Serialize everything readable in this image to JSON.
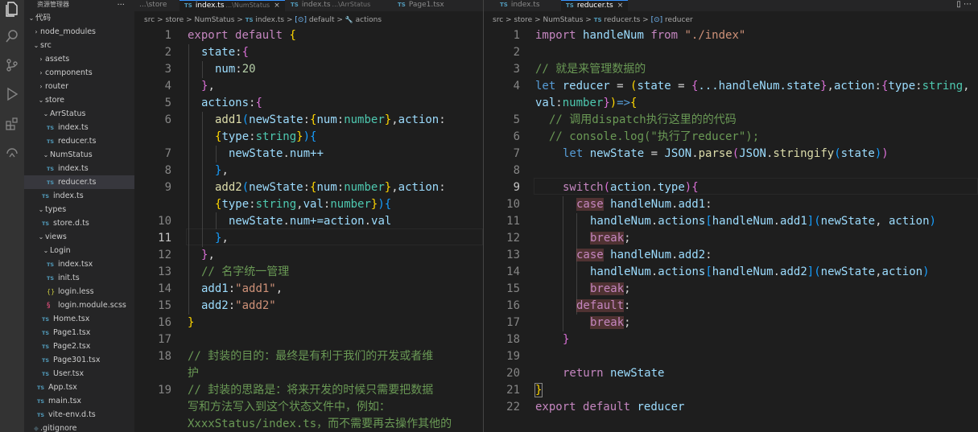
{
  "sidebar": {
    "title": "资源管理器",
    "more": "...",
    "tree": [
      {
        "label": "代码",
        "depth": 0,
        "chev": "⌄",
        "icon": "folder-open"
      },
      {
        "label": "node_modules",
        "depth": 1,
        "chev": "›",
        "icon": "folder"
      },
      {
        "label": "src",
        "depth": 1,
        "chev": "⌄",
        "icon": "folder-open"
      },
      {
        "label": "assets",
        "depth": 2,
        "chev": "›",
        "icon": "folder"
      },
      {
        "label": "components",
        "depth": 2,
        "chev": "›",
        "icon": "folder"
      },
      {
        "label": "router",
        "depth": 2,
        "chev": "›",
        "icon": "folder"
      },
      {
        "label": "store",
        "depth": 2,
        "chev": "⌄",
        "icon": "folder-open"
      },
      {
        "label": "ArrStatus",
        "depth": 3,
        "chev": "⌄",
        "icon": "folder-open"
      },
      {
        "label": "index.ts",
        "depth": 4,
        "icon": "ts"
      },
      {
        "label": "reducer.ts",
        "depth": 4,
        "icon": "ts"
      },
      {
        "label": "NumStatus",
        "depth": 3,
        "chev": "⌄",
        "icon": "folder-open"
      },
      {
        "label": "index.ts",
        "depth": 4,
        "icon": "ts"
      },
      {
        "label": "reducer.ts",
        "depth": 4,
        "icon": "ts",
        "selected": true
      },
      {
        "label": "index.ts",
        "depth": 3,
        "icon": "ts"
      },
      {
        "label": "types",
        "depth": 2,
        "chev": "⌄",
        "icon": "folder-open"
      },
      {
        "label": "store.d.ts",
        "depth": 3,
        "icon": "ts"
      },
      {
        "label": "views",
        "depth": 2,
        "chev": "⌄",
        "icon": "folder-open"
      },
      {
        "label": "Login",
        "depth": 3,
        "chev": "⌄",
        "icon": "folder-open"
      },
      {
        "label": "index.tsx",
        "depth": 4,
        "icon": "ts"
      },
      {
        "label": "init.ts",
        "depth": 4,
        "icon": "ts"
      },
      {
        "label": "login.less",
        "depth": 4,
        "icon": "css"
      },
      {
        "label": "login.module.scss",
        "depth": 4,
        "icon": "scss"
      },
      {
        "label": "Home.tsx",
        "depth": 3,
        "icon": "ts"
      },
      {
        "label": "Page1.tsx",
        "depth": 3,
        "icon": "ts"
      },
      {
        "label": "Page2.tsx",
        "depth": 3,
        "icon": "ts"
      },
      {
        "label": "Page301.tsx",
        "depth": 3,
        "icon": "ts"
      },
      {
        "label": "User.tsx",
        "depth": 3,
        "icon": "ts"
      },
      {
        "label": "App.tsx",
        "depth": 2,
        "icon": "ts"
      },
      {
        "label": "main.tsx",
        "depth": 2,
        "icon": "ts"
      },
      {
        "label": "vite-env.d.ts",
        "depth": 2,
        "icon": "ts"
      },
      {
        "label": ".gitignore",
        "depth": 1,
        "icon": "git"
      }
    ]
  },
  "left_editor": {
    "tabs": [
      {
        "name": "...\\store",
        "desc": "",
        "active": false,
        "badge": ""
      },
      {
        "name": "index.ts",
        "desc": "...\\NumStatus",
        "active": true,
        "badge": "TS",
        "close": "×"
      },
      {
        "name": "index.ts",
        "desc": "...\\ArrStatus",
        "active": false,
        "badge": "TS"
      },
      {
        "name": "Page1.tsx",
        "desc": "",
        "active": false,
        "badge": "TS"
      }
    ],
    "breadcrumb": {
      "parts": [
        "src",
        "store",
        "NumStatus"
      ],
      "file": "index.ts",
      "badge": "TS",
      "sym1": "default",
      "sym2": "actions",
      "sep": ">"
    },
    "current_line": "11"
  },
  "right_editor": {
    "tabs": [
      {
        "name": "index.ts",
        "desc": "",
        "active": false,
        "badge": "TS"
      },
      {
        "name": "reducer.ts",
        "desc": "",
        "active": true,
        "badge": "TS",
        "close": "×"
      }
    ],
    "breadcrumb": {
      "parts": [
        "src",
        "store",
        "NumStatus"
      ],
      "file": "reducer.ts",
      "badge": "TS",
      "sym1": "reducer",
      "sep": ">"
    },
    "current_line": "9"
  },
  "icons": {
    "explorer": "files-icon",
    "search": "search-icon",
    "scm": "source-control-icon",
    "debug": "run-debug-icon",
    "extensions": "extensions-icon",
    "remote": "remote-icon"
  },
  "colors": {
    "keyword": "#c586c0",
    "string": "#ce9178",
    "comment": "#6a9955",
    "type": "#4ec9b0",
    "variable": "#9cdcfe",
    "function": "#dcdcaa",
    "number": "#b5cea8"
  },
  "text": {
    "L01": "export",
    "L01b": "default",
    "L02": "state",
    "L03": "num",
    "L03v": "20",
    "L05": "actions",
    "L06a": "add1",
    "L06b": "newState",
    "L06c": "num",
    "L06d": "number",
    "L06e": "action",
    "L06f": "type",
    "L06g": "string",
    "L07": "newState",
    "L07b": "num++",
    "L09a": "add2",
    "L09b": "newState",
    "L09c": "num",
    "L09d": "number",
    "L09e": "action",
    "L09f": "type",
    "L09g": "string",
    "L09h": "val",
    "L09i": "number",
    "L10a": "newState",
    "L10b": "num+=",
    "L10c": "action",
    "L10d": "val",
    "L13": "// 名字统一管理",
    "L14a": "add1",
    "L14b": "\"add1\"",
    "L15a": "add2",
    "L15b": "\"add2\"",
    "L18a": "// 封装的目的：最终是有利于我们的开发或者维",
    "L18b": "护",
    "L19a": "// 封装的思路是：将来开发的时候只需要把数据",
    "L19b": "写和方法写入到这个状态文件中，例如：",
    "L19c": "XxxxStatus/index.ts，而不需要再去操作其他的",
    "R01a": "import",
    "R01b": "handleNum",
    "R01c": "from",
    "R01d": "\"./index\"",
    "R03": "// 就是来管理数据的",
    "R04a": "let",
    "R04b": "reducer",
    "R04c": "state",
    "R04d": "...handleNum.state",
    "R04e": "action",
    "R04f": "type",
    "R04g": "string",
    "R04h": "val",
    "R04i": "number",
    "R05": "// 调用dispatch执行这里的的代码",
    "R06": "// console.log(\"执行了reducer\");",
    "R07a": "let",
    "R07b": "newState",
    "R07c": "JSON",
    "R07d": "parse",
    "R07e": "JSON",
    "R07f": "stringify",
    "R07g": "state",
    "R09a": "switch",
    "R09b": "action",
    "R09c": "type",
    "R10a": "case",
    "R10b": "handleNum",
    "R10c": "add1",
    "R11a": "handleNum",
    "R11b": "actions",
    "R11c": "handleNum",
    "R11d": "add1",
    "R11e": "newState",
    "R11f": "action",
    "R12": "break",
    "R13a": "case",
    "R13b": "handleNum",
    "R13c": "add2",
    "R14a": "handleNum",
    "R14b": "actions",
    "R14c": "handleNum",
    "R14d": "add2",
    "R14e": "newState",
    "R14f": "action",
    "R15": "break",
    "R16": "default",
    "R17": "break",
    "R20a": "return",
    "R20b": "newState",
    "R22a": "export",
    "R22b": "default",
    "R22c": "reducer"
  }
}
